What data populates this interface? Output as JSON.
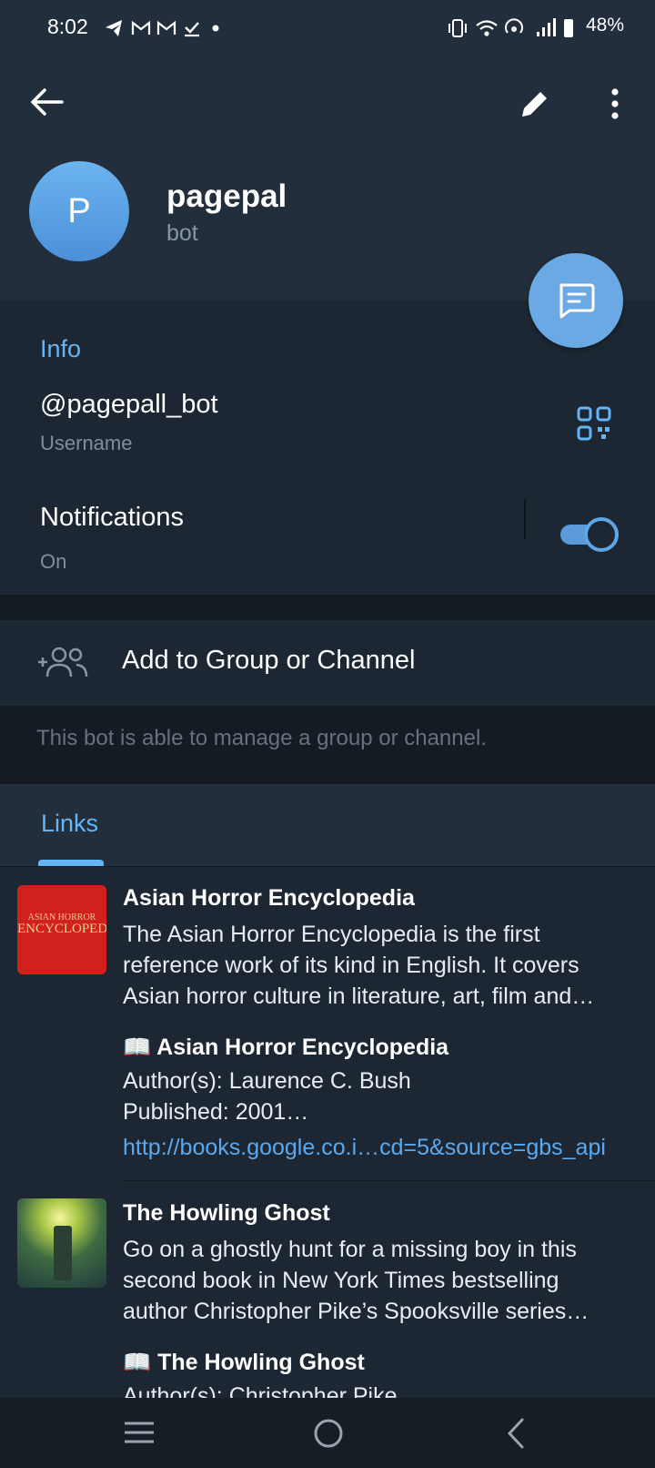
{
  "status_bar": {
    "time": "8:02",
    "left_icons": [
      "telegram-icon",
      "gmail-icon",
      "gmail-icon",
      "task-icon",
      "dot-icon"
    ],
    "battery": "48%"
  },
  "profile": {
    "avatar_letter": "P",
    "name": "pagepal",
    "subtitle": "bot"
  },
  "info": {
    "section_title": "Info",
    "username": "@pagepall_bot",
    "username_label": "Username",
    "notifications_label": "Notifications",
    "notifications_value": "On",
    "notifications_enabled": true
  },
  "actions": {
    "add_to_group": "Add to Group or Channel",
    "hint": "This bot is able to manage a group or channel."
  },
  "links": {
    "tab_label": "Links",
    "items": [
      {
        "thumb_text_top": "ASIAN HORROR",
        "thumb_text_bottom": "ENCYCLOPEDIA",
        "title": "Asian Horror Encyclopedia",
        "desc_lines": [
          "The Asian Horror Encyclopedia is the first",
          "reference work of its kind in English. It covers",
          "Asian horror culture in literature, art, film and…"
        ],
        "book_title": "📖 Asian Horror Encyclopedia",
        "author": "Author(s): Laurence C. Bush",
        "published": "Published: 2001…",
        "url": "http://books.google.co.i…cd=5&source=gbs_api"
      },
      {
        "title": "The Howling Ghost",
        "desc_lines": [
          "Go on a ghostly hunt for a missing boy in this",
          "second book in New York Times bestselling",
          "author Christopher Pike’s Spooksville series…"
        ],
        "book_title": "📖 The Howling Ghost",
        "author": "Author(s): Christopher Pike"
      }
    ]
  },
  "colors": {
    "accent": "#64b5f6",
    "background": "#1d2733",
    "header": "#232e3c",
    "thumb_red": "#d0211d"
  }
}
